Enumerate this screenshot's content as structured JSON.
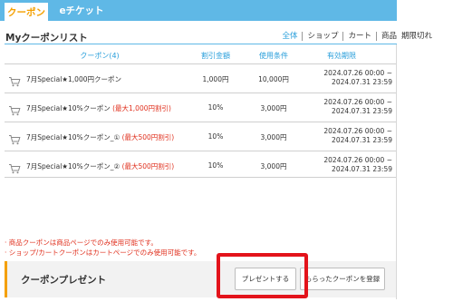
{
  "tabs": {
    "coupon": "クーポン",
    "eticket": "eチケット"
  },
  "section": {
    "title": "Myクーポンリスト"
  },
  "filters": {
    "all": "全体",
    "shop": "ショップ",
    "cart": "カート",
    "product": "商品",
    "expired": "期限切れ"
  },
  "table": {
    "headers": {
      "coupon": "クーポン(4)",
      "discount": "割引金額",
      "condition": "使用条件",
      "period": "有効期限"
    },
    "rows": [
      {
        "name": "7月Special★1,000円クーポン",
        "note": "",
        "discount": "1,000円",
        "condition": "10,000円",
        "period_start": "2024.07.26 00:00 ~",
        "period_end": "2024.07.31 23:59"
      },
      {
        "name": "7月Special★10%クーポン",
        "note": "(最大1,000円割引)",
        "discount": "10%",
        "condition": "3,000円",
        "period_start": "2024.07.26 00:00 ~",
        "period_end": "2024.07.31 23:59"
      },
      {
        "name": "7月Special★10%クーポン_①",
        "note": "(最大500円割引)",
        "discount": "10%",
        "condition": "3,000円",
        "period_start": "2024.07.26 00:00 ~",
        "period_end": "2024.07.31 23:59"
      },
      {
        "name": "7月Special★10%クーポン_②",
        "note": "(最大500円割引)",
        "discount": "10%",
        "condition": "3,000円",
        "period_start": "2024.07.26 00:00 ~",
        "period_end": "2024.07.31 23:59"
      }
    ]
  },
  "notes": {
    "line1": "· 商品クーポンは商品ページでのみ使用可能です。",
    "line2": "· ショップ/カートクーポンはカートページでのみ使用可能です。"
  },
  "present": {
    "title": "クーポンプレゼント",
    "present_button": "プレゼントする",
    "register_button": "もらったクーポンを登録"
  },
  "colors": {
    "tab_bar": "#5fb8e6",
    "accent_orange": "#f4a000",
    "link_blue": "#2a9fdb",
    "note_red": "#e0301e",
    "highlight_red": "#e3131b"
  },
  "icons": {
    "row_icon": "cart-icon"
  }
}
